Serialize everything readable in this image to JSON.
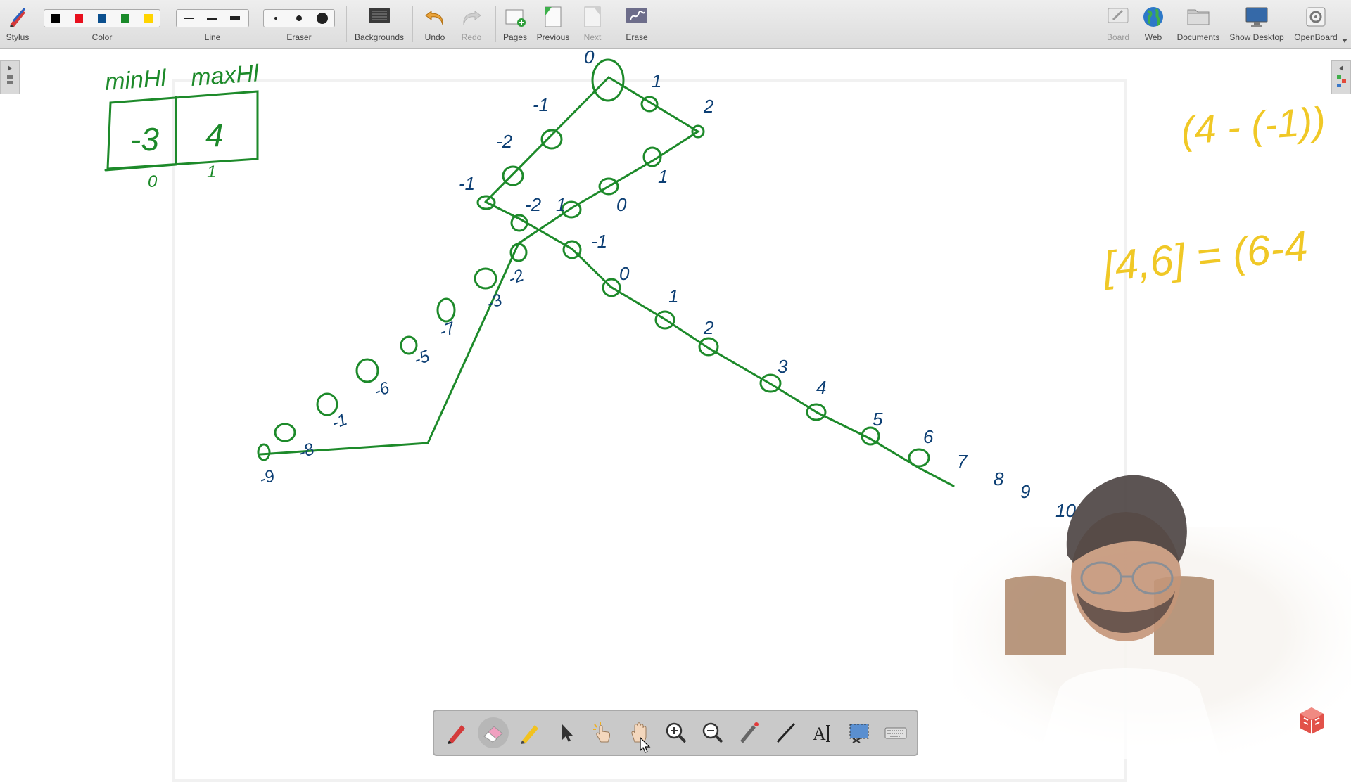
{
  "toolbar": {
    "stylus": "Stylus",
    "color": "Color",
    "line": "Line",
    "eraser": "Eraser",
    "backgrounds": "Backgrounds",
    "undo": "Undo",
    "redo": "Redo",
    "pages": "Pages",
    "previous": "Previous",
    "next": "Next",
    "erase": "Erase",
    "board": "Board",
    "web": "Web",
    "documents": "Documents",
    "show_desktop": "Show Desktop",
    "openboard": "OpenBoard",
    "colors": [
      "#000000",
      "#e8101e",
      "#0b4f8e",
      "#1a8a2a",
      "#ffd400"
    ]
  },
  "board": {
    "ink_colors": {
      "green": "#1d8a2a",
      "blue": "#0d3f74",
      "yellow": "#f0c826"
    },
    "table": {
      "headers": [
        "minHl",
        "maxHl"
      ],
      "values": [
        "-3",
        "4"
      ],
      "indices": [
        "0",
        "1"
      ]
    },
    "level_labels_upper": [
      "0",
      "-1",
      "-2",
      "-1",
      "1",
      "2",
      "1",
      "0",
      "-2",
      "1"
    ],
    "level_labels_lower_left": [
      "-9",
      "-8",
      "-7",
      "-6",
      "-5",
      "-3",
      "-2",
      "-1"
    ],
    "level_labels_lower_right": [
      "-1",
      "0",
      "1",
      "2",
      "3",
      "4",
      "5",
      "6",
      "7",
      "8",
      "9",
      "10"
    ],
    "right_notes": [
      "(4 - (-1))",
      "[4,6] = (6-4"
    ]
  },
  "dock": {
    "tools": [
      "pen-icon",
      "eraser-icon",
      "marker-icon",
      "selector-icon",
      "interactor-icon",
      "hand-icon",
      "zoom-in-icon",
      "zoom-out-icon",
      "laser-pointer-icon",
      "line-icon",
      "text-icon",
      "capture-icon",
      "keyboard-icon"
    ],
    "active": "eraser-icon"
  }
}
